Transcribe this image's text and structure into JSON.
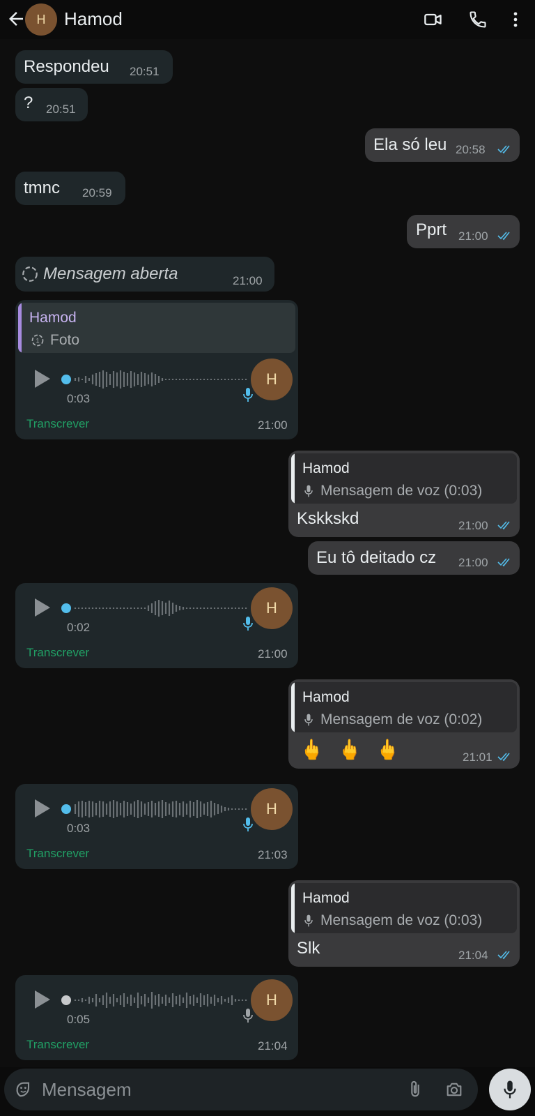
{
  "header": {
    "contact_name": "Hamod",
    "avatar_initial": "H"
  },
  "messages": {
    "m1": {
      "text": "Respondeu",
      "time": "20:51"
    },
    "m2": {
      "text": "?",
      "time": "20:51"
    },
    "m3": {
      "text": "Ela só leu",
      "time": "20:58"
    },
    "m4": {
      "text": "tmnc",
      "time": "20:59"
    },
    "m5": {
      "text": "Pprt",
      "time": "21:00"
    },
    "m6": {
      "text": "Mensagem aberta",
      "time": "21:00"
    },
    "m7": {
      "quote_name": "Hamod",
      "quote_text": "Foto",
      "duration": "0:03",
      "transcribe": "Transcrever",
      "time": "21:00",
      "avatar": "H"
    },
    "m8": {
      "quote_name": "Hamod",
      "quote_text": "Mensagem de voz (0:03)",
      "text": "Kskkskd",
      "time": "21:00"
    },
    "m9": {
      "text": "Eu tô deitado cz",
      "time": "21:00"
    },
    "m10": {
      "duration": "0:02",
      "transcribe": "Transcrever",
      "time": "21:00",
      "avatar": "H"
    },
    "m11": {
      "quote_name": "Hamod",
      "quote_text": "Mensagem de voz (0:02)",
      "text": "🖕 🖕 🖕",
      "time": "21:01"
    },
    "m12": {
      "duration": "0:03",
      "transcribe": "Transcrever",
      "time": "21:03",
      "avatar": "H"
    },
    "m13": {
      "quote_name": "Hamod",
      "quote_text": "Mensagem de voz (0:03)",
      "text": "Slk",
      "time": "21:04"
    },
    "m14": {
      "duration": "0:05",
      "transcribe": "Transcrever",
      "time": "21:04",
      "avatar": "H"
    }
  },
  "composer": {
    "placeholder": "Mensagem"
  },
  "colors": {
    "read_ticks": "#53bdeb",
    "transcribe": "#21a065",
    "voice_dot_unplayed": "#53bdeb",
    "voice_dot_played": "#c7c9cb",
    "avatar": "#7a5230"
  },
  "icons": [
    "back-arrow-icon",
    "video-call-icon",
    "phone-icon",
    "more-vert-icon",
    "view-once-icon",
    "mic-icon",
    "sticker-icon",
    "attach-icon",
    "camera-icon"
  ]
}
